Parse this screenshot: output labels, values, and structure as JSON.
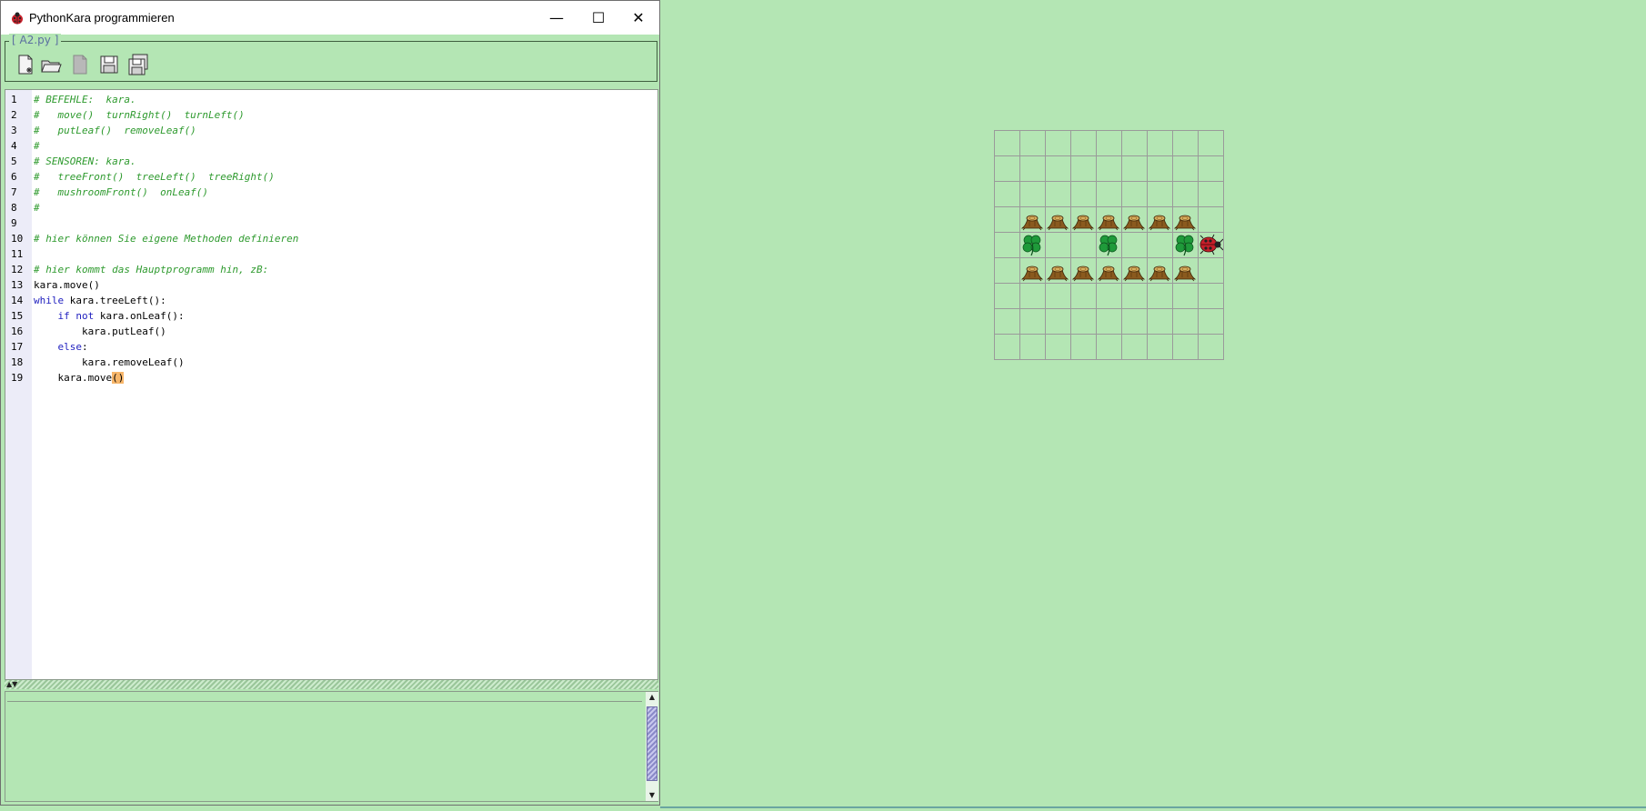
{
  "window": {
    "title": "PythonKara programmieren",
    "file_label": "[ A2.py ]",
    "controls": {
      "minimize": "—",
      "maximize": "☐",
      "close": "✕"
    }
  },
  "toolbar": {
    "buttons": [
      {
        "name": "new-file-button",
        "icon": "new-file-icon"
      },
      {
        "name": "open-file-button",
        "icon": "open-folder-icon"
      },
      {
        "name": "close-file-button",
        "icon": "document-icon",
        "disabled": true
      },
      {
        "name": "save-button",
        "icon": "floppy-disk-icon"
      },
      {
        "name": "save-as-button",
        "icon": "save-as-icon"
      }
    ]
  },
  "editor": {
    "lines": [
      {
        "n": "1",
        "text": "# BEFEHLE:  kara.",
        "type": "comment"
      },
      {
        "n": "2",
        "text": "#   move()  turnRight()  turnLeft()",
        "type": "comment"
      },
      {
        "n": "3",
        "text": "#   putLeaf()  removeLeaf()",
        "type": "comment"
      },
      {
        "n": "4",
        "text": "#",
        "type": "comment"
      },
      {
        "n": "5",
        "text": "# SENSOREN: kara.",
        "type": "comment"
      },
      {
        "n": "6",
        "text": "#   treeFront()  treeLeft()  treeRight()",
        "type": "comment"
      },
      {
        "n": "7",
        "text": "#   mushroomFront()  onLeaf()",
        "type": "comment"
      },
      {
        "n": "8",
        "text": "#",
        "type": "comment"
      },
      {
        "n": "9",
        "text": "",
        "type": "plain"
      },
      {
        "n": "10",
        "text": "# hier können Sie eigene Methoden definieren",
        "type": "comment"
      },
      {
        "n": "11",
        "text": "",
        "type": "plain"
      },
      {
        "n": "12",
        "text": "# hier kommt das Hauptprogramm hin, zB:",
        "type": "comment"
      },
      {
        "n": "13",
        "text": "kara.move()",
        "type": "plain"
      },
      {
        "n": "14",
        "kw": "while",
        "rest": " kara.treeLeft():",
        "indent": "",
        "type": "kw"
      },
      {
        "n": "15",
        "kw": "if not",
        "rest": " kara.onLeaf():",
        "indent": "    ",
        "type": "kw"
      },
      {
        "n": "16",
        "text": "        kara.putLeaf()",
        "type": "plain"
      },
      {
        "n": "17",
        "kw": "else",
        "rest": ":",
        "indent": "    ",
        "type": "kw"
      },
      {
        "n": "18",
        "text": "        kara.removeLeaf()",
        "type": "plain"
      },
      {
        "n": "19",
        "pre": "    kara.move",
        "hl": "()",
        "type": "cursor"
      }
    ]
  },
  "world": {
    "cols": 9,
    "rows": 9,
    "trees": [
      [
        1,
        3
      ],
      [
        2,
        3
      ],
      [
        3,
        3
      ],
      [
        4,
        3
      ],
      [
        5,
        3
      ],
      [
        6,
        3
      ],
      [
        7,
        3
      ],
      [
        1,
        5
      ],
      [
        2,
        5
      ],
      [
        3,
        5
      ],
      [
        4,
        5
      ],
      [
        5,
        5
      ],
      [
        6,
        5
      ],
      [
        7,
        5
      ]
    ],
    "leaves": [
      [
        1,
        4
      ],
      [
        4,
        4
      ],
      [
        7,
        4
      ]
    ],
    "kara": [
      8,
      4
    ],
    "kara_direction": "east",
    "colors": {
      "background": "#b4e6b4",
      "grid": "#9a9a9a",
      "comment": "#2e9a2e",
      "keyword": "#1f1fbf"
    }
  }
}
